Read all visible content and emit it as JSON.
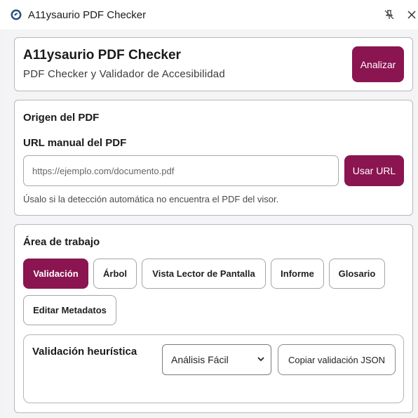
{
  "window": {
    "title": "A11ysaurio PDF Checker",
    "icons": {
      "app": "app-logo-icon",
      "unpin": "unpin-icon",
      "close": "close-icon"
    }
  },
  "header": {
    "title": "A11ysaurio PDF Checker",
    "subtitle": "PDF Checker y Validador de Accesibilidad",
    "analyze_label": "Analizar"
  },
  "origin": {
    "section_title": "Origen del PDF",
    "url_label": "URL manual del PDF",
    "url_placeholder": "https://ejemplo.com/documento.pdf",
    "url_value": "",
    "use_url_label": "Usar URL",
    "hint": "Úsalo si la detección automática no encuentra el PDF del visor."
  },
  "workspace": {
    "title": "Área de trabajo",
    "tabs": [
      {
        "label": "Validación",
        "active": true
      },
      {
        "label": "Árbol",
        "active": false
      },
      {
        "label": "Vista Lector de Pantalla",
        "active": false
      },
      {
        "label": "Informe",
        "active": false
      },
      {
        "label": "Glosario",
        "active": false
      },
      {
        "label": "Editar Metadatos",
        "active": false
      }
    ],
    "validation": {
      "title": "Validación heurística",
      "mode_selected": "Análisis Fácil",
      "copy_label": "Copiar validación JSON"
    }
  },
  "colors": {
    "accent": "#8a1550",
    "border": "#b8b8b8",
    "background": "#f4f4f6"
  }
}
